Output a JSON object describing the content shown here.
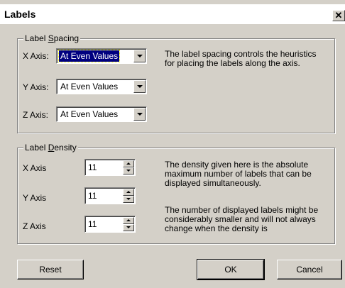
{
  "window": {
    "title": "Labels",
    "close_symbol": "✕"
  },
  "label_spacing": {
    "legend_pre": "Label ",
    "legend_mnemonic": "S",
    "legend_post": "pacing",
    "rows": [
      {
        "label": "X Axis:",
        "value": "At Even Values"
      },
      {
        "label": "Y Axis:",
        "value": "At Even Values"
      },
      {
        "label": "Z Axis:",
        "value": "At Even Values"
      }
    ],
    "description": "The label spacing controls the heuristics for placing the labels along the axis."
  },
  "label_density": {
    "legend_pre": "Label ",
    "legend_mnemonic": "D",
    "legend_post": "ensity",
    "rows": [
      {
        "label": "X Axis",
        "value": "11"
      },
      {
        "label": "Y Axis",
        "value": "11"
      },
      {
        "label": "Z Axis",
        "value": "11"
      }
    ],
    "description1": "The density given here is the absolute maximum number of labels that can be displayed simultaneously.",
    "description2": "The number of displayed labels might be considerably smaller and will not always change when the density is"
  },
  "buttons": {
    "reset": "Reset",
    "ok": "OK",
    "cancel": "Cancel"
  }
}
